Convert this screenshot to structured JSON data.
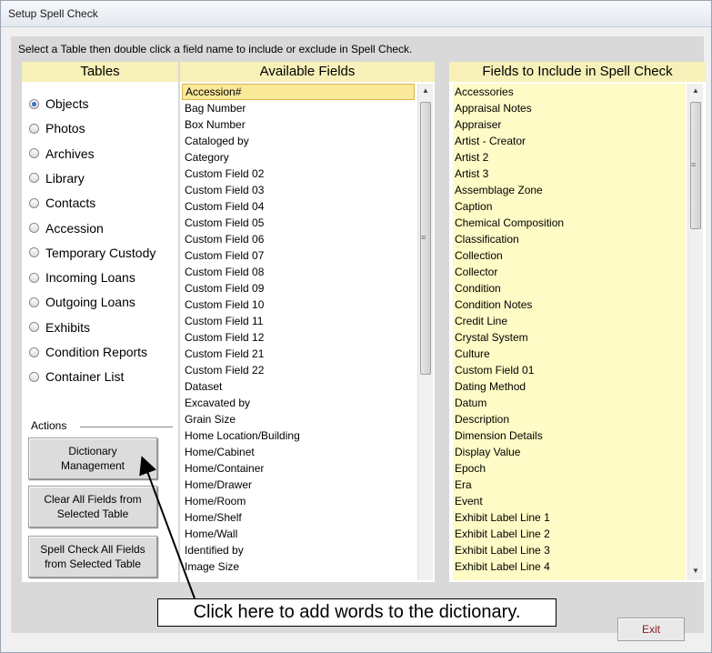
{
  "window": {
    "title": "Setup Spell Check"
  },
  "instructions": "Select a Table then double click a field name to include or exclude in Spell Check.",
  "tables_panel": {
    "header": "Tables",
    "options": [
      {
        "label": "Objects",
        "selected": true
      },
      {
        "label": "Photos",
        "selected": false
      },
      {
        "label": "Archives",
        "selected": false
      },
      {
        "label": "Library",
        "selected": false
      },
      {
        "label": "Contacts",
        "selected": false
      },
      {
        "label": "Accession",
        "selected": false
      },
      {
        "label": "Temporary Custody",
        "selected": false
      },
      {
        "label": "Incoming Loans",
        "selected": false
      },
      {
        "label": "Outgoing Loans",
        "selected": false
      },
      {
        "label": "Exhibits",
        "selected": false
      },
      {
        "label": "Condition Reports",
        "selected": false
      },
      {
        "label": "Container List",
        "selected": false
      }
    ],
    "actions_label": "Actions",
    "buttons": {
      "dictionary_1": "Dictionary",
      "dictionary_2": "Management",
      "clear_1": "Clear All Fields from",
      "clear_2": "Selected Table",
      "spell_1": "Spell Check All  Fields",
      "spell_2": "from Selected Table"
    }
  },
  "available_panel": {
    "header": "Available Fields",
    "fields": [
      "Accession#",
      "Bag Number",
      "Box Number",
      "Cataloged by",
      "Category",
      "Custom Field 02",
      "Custom Field 03",
      "Custom Field 04",
      "Custom Field 05",
      "Custom Field 06",
      "Custom Field 07",
      "Custom Field 08",
      "Custom Field 09",
      "Custom Field 10",
      "Custom Field 11",
      "Custom Field 12",
      "Custom Field 21",
      "Custom Field 22",
      "Dataset",
      "Excavated by",
      "Grain Size",
      "Home Location/Building",
      "Home/Cabinet",
      "Home/Container",
      "Home/Drawer",
      "Home/Room",
      "Home/Shelf",
      "Home/Wall",
      "Identified by",
      "Image Size"
    ],
    "selected_index": 0
  },
  "include_panel": {
    "header": "Fields to Include in Spell Check",
    "fields": [
      "Accessories",
      "Appraisal Notes",
      "Appraiser",
      "Artist - Creator",
      "Artist 2",
      "Artist 3",
      "Assemblage Zone",
      "Caption",
      "Chemical Composition",
      "Classification",
      "Collection",
      "Collector",
      "Condition",
      "Condition Notes",
      "Credit Line",
      "Crystal System",
      "Culture",
      "Custom Field 01",
      "Dating Method",
      "Datum",
      "Description",
      "Dimension Details",
      "Display Value",
      "Epoch",
      "Era",
      "Event",
      "Exhibit Label Line 1",
      "Exhibit Label Line 2",
      "Exhibit Label Line 3",
      "Exhibit Label Line 4"
    ]
  },
  "callout": "Click here to add words to the dictionary.",
  "exit_label": "Exit",
  "colors": {
    "panel_header": "#f7f0b8",
    "include_bg": "#fffbc6",
    "selected_item": "#fbe99a",
    "exit_text": "#8a1b1b"
  }
}
